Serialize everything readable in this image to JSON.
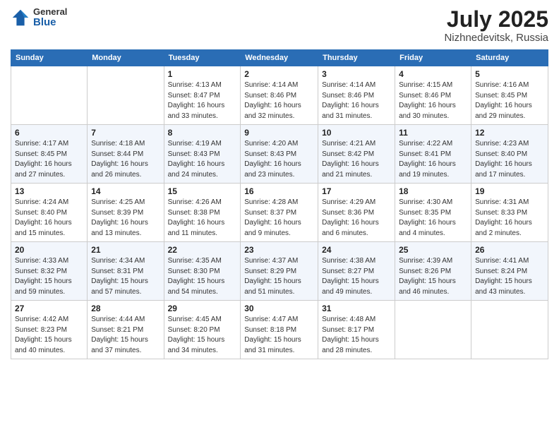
{
  "header": {
    "logo_general": "General",
    "logo_blue": "Blue",
    "title": "July 2025",
    "location": "Nizhnedevitsk, Russia"
  },
  "columns": [
    "Sunday",
    "Monday",
    "Tuesday",
    "Wednesday",
    "Thursday",
    "Friday",
    "Saturday"
  ],
  "weeks": [
    [
      {
        "date": "",
        "info": ""
      },
      {
        "date": "",
        "info": ""
      },
      {
        "date": "1",
        "info": "Sunrise: 4:13 AM\nSunset: 8:47 PM\nDaylight: 16 hours\nand 33 minutes."
      },
      {
        "date": "2",
        "info": "Sunrise: 4:14 AM\nSunset: 8:46 PM\nDaylight: 16 hours\nand 32 minutes."
      },
      {
        "date": "3",
        "info": "Sunrise: 4:14 AM\nSunset: 8:46 PM\nDaylight: 16 hours\nand 31 minutes."
      },
      {
        "date": "4",
        "info": "Sunrise: 4:15 AM\nSunset: 8:46 PM\nDaylight: 16 hours\nand 30 minutes."
      },
      {
        "date": "5",
        "info": "Sunrise: 4:16 AM\nSunset: 8:45 PM\nDaylight: 16 hours\nand 29 minutes."
      }
    ],
    [
      {
        "date": "6",
        "info": "Sunrise: 4:17 AM\nSunset: 8:45 PM\nDaylight: 16 hours\nand 27 minutes."
      },
      {
        "date": "7",
        "info": "Sunrise: 4:18 AM\nSunset: 8:44 PM\nDaylight: 16 hours\nand 26 minutes."
      },
      {
        "date": "8",
        "info": "Sunrise: 4:19 AM\nSunset: 8:43 PM\nDaylight: 16 hours\nand 24 minutes."
      },
      {
        "date": "9",
        "info": "Sunrise: 4:20 AM\nSunset: 8:43 PM\nDaylight: 16 hours\nand 23 minutes."
      },
      {
        "date": "10",
        "info": "Sunrise: 4:21 AM\nSunset: 8:42 PM\nDaylight: 16 hours\nand 21 minutes."
      },
      {
        "date": "11",
        "info": "Sunrise: 4:22 AM\nSunset: 8:41 PM\nDaylight: 16 hours\nand 19 minutes."
      },
      {
        "date": "12",
        "info": "Sunrise: 4:23 AM\nSunset: 8:40 PM\nDaylight: 16 hours\nand 17 minutes."
      }
    ],
    [
      {
        "date": "13",
        "info": "Sunrise: 4:24 AM\nSunset: 8:40 PM\nDaylight: 16 hours\nand 15 minutes."
      },
      {
        "date": "14",
        "info": "Sunrise: 4:25 AM\nSunset: 8:39 PM\nDaylight: 16 hours\nand 13 minutes."
      },
      {
        "date": "15",
        "info": "Sunrise: 4:26 AM\nSunset: 8:38 PM\nDaylight: 16 hours\nand 11 minutes."
      },
      {
        "date": "16",
        "info": "Sunrise: 4:28 AM\nSunset: 8:37 PM\nDaylight: 16 hours\nand 9 minutes."
      },
      {
        "date": "17",
        "info": "Sunrise: 4:29 AM\nSunset: 8:36 PM\nDaylight: 16 hours\nand 6 minutes."
      },
      {
        "date": "18",
        "info": "Sunrise: 4:30 AM\nSunset: 8:35 PM\nDaylight: 16 hours\nand 4 minutes."
      },
      {
        "date": "19",
        "info": "Sunrise: 4:31 AM\nSunset: 8:33 PM\nDaylight: 16 hours\nand 2 minutes."
      }
    ],
    [
      {
        "date": "20",
        "info": "Sunrise: 4:33 AM\nSunset: 8:32 PM\nDaylight: 15 hours\nand 59 minutes."
      },
      {
        "date": "21",
        "info": "Sunrise: 4:34 AM\nSunset: 8:31 PM\nDaylight: 15 hours\nand 57 minutes."
      },
      {
        "date": "22",
        "info": "Sunrise: 4:35 AM\nSunset: 8:30 PM\nDaylight: 15 hours\nand 54 minutes."
      },
      {
        "date": "23",
        "info": "Sunrise: 4:37 AM\nSunset: 8:29 PM\nDaylight: 15 hours\nand 51 minutes."
      },
      {
        "date": "24",
        "info": "Sunrise: 4:38 AM\nSunset: 8:27 PM\nDaylight: 15 hours\nand 49 minutes."
      },
      {
        "date": "25",
        "info": "Sunrise: 4:39 AM\nSunset: 8:26 PM\nDaylight: 15 hours\nand 46 minutes."
      },
      {
        "date": "26",
        "info": "Sunrise: 4:41 AM\nSunset: 8:24 PM\nDaylight: 15 hours\nand 43 minutes."
      }
    ],
    [
      {
        "date": "27",
        "info": "Sunrise: 4:42 AM\nSunset: 8:23 PM\nDaylight: 15 hours\nand 40 minutes."
      },
      {
        "date": "28",
        "info": "Sunrise: 4:44 AM\nSunset: 8:21 PM\nDaylight: 15 hours\nand 37 minutes."
      },
      {
        "date": "29",
        "info": "Sunrise: 4:45 AM\nSunset: 8:20 PM\nDaylight: 15 hours\nand 34 minutes."
      },
      {
        "date": "30",
        "info": "Sunrise: 4:47 AM\nSunset: 8:18 PM\nDaylight: 15 hours\nand 31 minutes."
      },
      {
        "date": "31",
        "info": "Sunrise: 4:48 AM\nSunset: 8:17 PM\nDaylight: 15 hours\nand 28 minutes."
      },
      {
        "date": "",
        "info": ""
      },
      {
        "date": "",
        "info": ""
      }
    ]
  ]
}
